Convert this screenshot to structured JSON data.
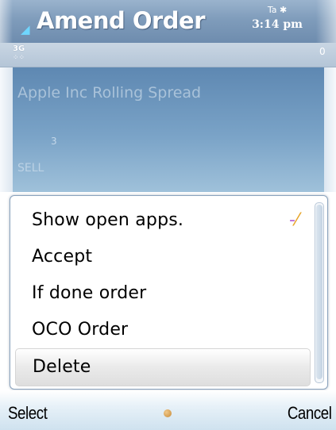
{
  "window": {
    "title": "Amend Order",
    "status_icons": "Ta ✱",
    "clock": "3:14 pm",
    "network": "3G",
    "battery_digit": "0"
  },
  "order": {
    "name": "Apple Inc Rolling Spread",
    "quantity": "3",
    "side": "SELL"
  },
  "menu": {
    "items": [
      {
        "label": "Show open apps.",
        "has_icon": true,
        "icon": "task-switcher-icon"
      },
      {
        "label": "Accept"
      },
      {
        "label": "If done order"
      },
      {
        "label": "OCO Order"
      },
      {
        "label": "Delete",
        "selected": true
      }
    ]
  },
  "softkeys": {
    "left": "Select",
    "right": "Cancel"
  },
  "colors": {
    "title_bar": "#7f9cbb",
    "content_bg": "#7aa3c7",
    "highlight": "#e6e6e6",
    "softkey_bg": "#dbe9f3"
  }
}
